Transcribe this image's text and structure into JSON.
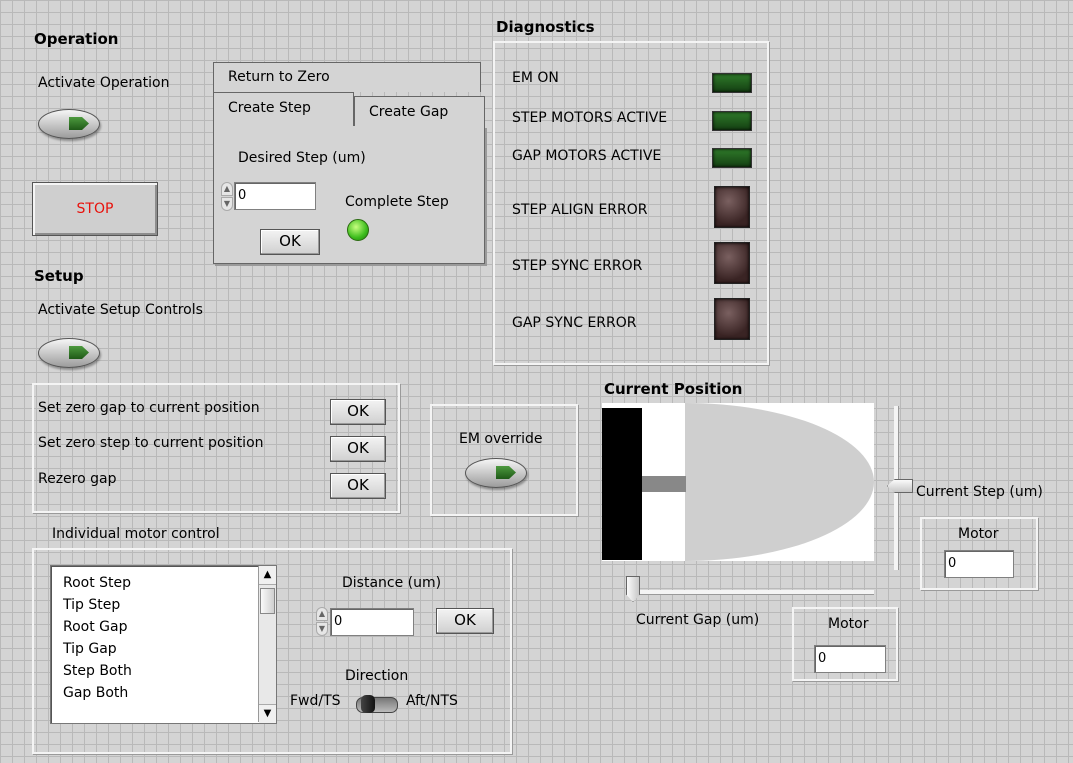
{
  "operation": {
    "heading": "Operation",
    "activate_label": "Activate Operation",
    "stop_label": "STOP",
    "stop_color": "#e8120c"
  },
  "tabs": {
    "return_to_zero": "Return to Zero",
    "create_step": "Create Step",
    "create_gap": "Create Gap",
    "desired_step_label": "Desired Step (um)",
    "desired_step_value": "0",
    "ok_label": "OK",
    "complete_step_label": "Complete Step"
  },
  "diagnostics": {
    "heading": "Diagnostics",
    "indicators": [
      {
        "label": "EM ON"
      },
      {
        "label": "STEP MOTORS ACTIVE"
      },
      {
        "label": "GAP MOTORS ACTIVE"
      },
      {
        "label": "STEP ALIGN ERROR"
      },
      {
        "label": "STEP SYNC ERROR"
      },
      {
        "label": "GAP SYNC ERROR"
      }
    ]
  },
  "setup": {
    "heading": "Setup",
    "activate_label": "Activate Setup Controls",
    "rows": [
      {
        "label": "Set zero gap to current position",
        "button": "OK"
      },
      {
        "label": "Set zero step to current position",
        "button": "OK"
      },
      {
        "label": "Rezero gap",
        "button": "OK"
      }
    ]
  },
  "em_override": {
    "label": "EM override"
  },
  "current_position": {
    "heading": "Current Position",
    "step_label": "Current Step (um)",
    "gap_label": "Current  Gap (um)",
    "step_motor_label": "Motor",
    "step_motor_value": "0",
    "gap_motor_label": "Motor",
    "gap_motor_value": "0"
  },
  "motor_control": {
    "title": "Individual motor control",
    "items": [
      "Root Step",
      "Tip Step",
      "Root Gap",
      "Tip Gap",
      "Step Both",
      "Gap Both"
    ],
    "distance_label": "Distance (um)",
    "distance_value": "0",
    "ok_label": "OK",
    "direction_label": "Direction",
    "fwd_label": "Fwd/TS",
    "aft_label": "Aft/NTS"
  }
}
